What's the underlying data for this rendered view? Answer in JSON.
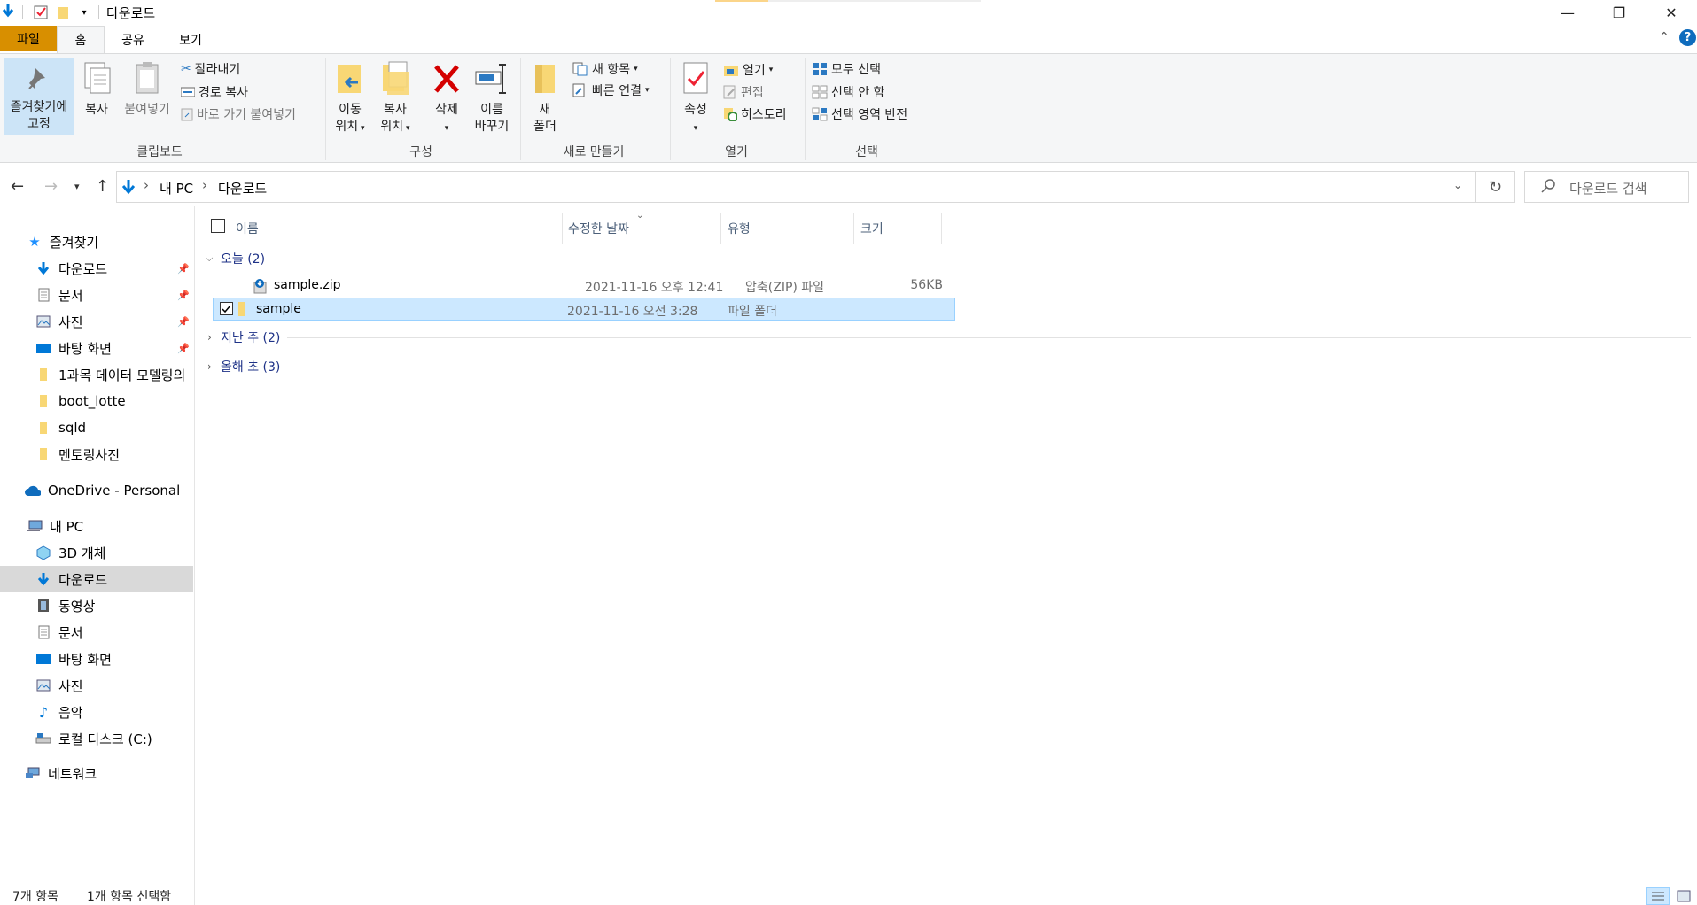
{
  "window": {
    "title": "다운로드",
    "controls": {
      "minimize": "—",
      "restore": "❐",
      "close": "✕"
    }
  },
  "ribbon_tabs": [
    {
      "label": "파일"
    },
    {
      "label": "홈"
    },
    {
      "label": "공유"
    },
    {
      "label": "보기"
    }
  ],
  "ribbon": {
    "clipboard": {
      "pin": "즐겨찾기에\n고정",
      "copy": "복사",
      "paste": "붙여넣기",
      "cut": "잘라내기",
      "copy_path": "경로 복사",
      "paste_shortcut": "바로 가기 붙여넣기",
      "label": "클립보드"
    },
    "organize": {
      "move_to_1": "이동",
      "move_to_2": "위치",
      "copy_to_1": "복사",
      "copy_to_2": "위치",
      "delete": "삭제",
      "rename_1": "이름",
      "rename_2": "바꾸기",
      "label": "구성"
    },
    "new": {
      "new_folder_1": "새",
      "new_folder_2": "폴더",
      "new_item": "새 항목",
      "easy_access": "빠른 연결",
      "label": "새로 만들기"
    },
    "open": {
      "properties": "속성",
      "open": "열기",
      "edit": "편집",
      "history": "히스토리",
      "label": "열기"
    },
    "select": {
      "select_all": "모두 선택",
      "select_none": "선택 안 함",
      "invert": "선택 영역 반전",
      "label": "선택"
    }
  },
  "address": {
    "path": [
      "내 PC",
      "다운로드"
    ],
    "search_placeholder": "다운로드 검색"
  },
  "navpane": {
    "quick_access": "즐겨찾기",
    "quick_items": [
      {
        "label": "다운로드",
        "pinned": true
      },
      {
        "label": "문서",
        "pinned": true
      },
      {
        "label": "사진",
        "pinned": true
      },
      {
        "label": "바탕 화면",
        "pinned": true
      },
      {
        "label": "1과목 데이터 모델링의",
        "pinned": false
      },
      {
        "label": "boot_lotte",
        "pinned": false
      },
      {
        "label": "sqld",
        "pinned": false
      },
      {
        "label": "멘토링사진",
        "pinned": false
      }
    ],
    "onedrive": "OneDrive - Personal",
    "this_pc": "내 PC",
    "pc_items": [
      {
        "label": "3D 개체"
      },
      {
        "label": "다운로드"
      },
      {
        "label": "동영상"
      },
      {
        "label": "문서"
      },
      {
        "label": "바탕 화면"
      },
      {
        "label": "사진"
      },
      {
        "label": "음악"
      },
      {
        "label": "로컬 디스크 (C:)"
      }
    ],
    "network": "네트워크"
  },
  "columns": {
    "name": "이름",
    "modified": "수정한 날짜",
    "type": "유형",
    "size": "크기"
  },
  "groups": {
    "today": "오늘 (2)",
    "last_week": "지난 주 (2)",
    "this_year": "올해 초 (3)"
  },
  "files": [
    {
      "name": "sample.zip",
      "modified": "2021-11-16 오후 12:41",
      "type": "압축(ZIP) 파일",
      "size": "56KB"
    },
    {
      "name": "sample",
      "modified": "2021-11-16 오전 3:28",
      "type": "파일 폴더",
      "size": ""
    }
  ],
  "status": {
    "count": "7개 항목",
    "selected": "1개 항목 선택함"
  },
  "colors": {
    "accent": "#0078d7",
    "file_tab": "#d88f00",
    "selection": "#cce8ff",
    "folder": "#f8d775"
  }
}
